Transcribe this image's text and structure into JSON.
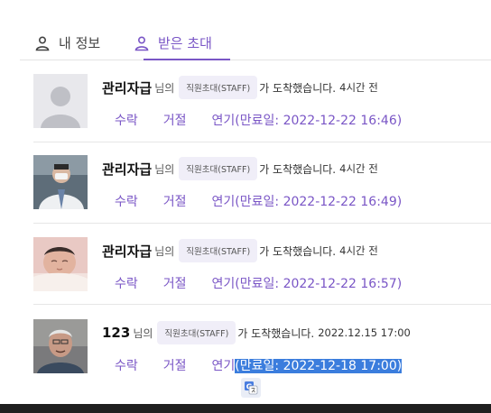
{
  "tabs": [
    {
      "label": "내 정보",
      "icon": "person-icon",
      "active": false
    },
    {
      "label": "받은 초대",
      "icon": "person-icon",
      "active": true
    }
  ],
  "invitations": [
    {
      "name": "관리자급",
      "suffix": "님의",
      "badge": "직원초대(STAFF)",
      "message": "가 도착했습니다.",
      "time": "4시간 전",
      "accept": "수락",
      "reject": "거절",
      "extend_prefix": "연기",
      "extend_rest": "(만료일: 2022-12-22 16:46)",
      "avatar": "default-avatar"
    },
    {
      "name": "관리자급",
      "suffix": "님의",
      "badge": "직원초대(STAFF)",
      "message": "가 도착했습니다.",
      "time": "4시간 전",
      "accept": "수락",
      "reject": "거절",
      "extend_prefix": "연기",
      "extend_rest": "(만료일: 2022-12-22 16:49)",
      "avatar": "doctor-photo"
    },
    {
      "name": "관리자급",
      "suffix": "님의",
      "badge": "직원초대(STAFF)",
      "message": "가 도착했습니다.",
      "time": "4시간 전",
      "accept": "수락",
      "reject": "거절",
      "extend_prefix": "연기",
      "extend_rest": "(만료일: 2022-12-22 16:57)",
      "avatar": "baby-photo"
    },
    {
      "name": "123",
      "suffix": "님의",
      "badge": "직원초대(STAFF)",
      "message": "가 도착했습니다.",
      "time": "2022.12.15 17:00",
      "accept": "수락",
      "reject": "거절",
      "extend_prefix": "연기",
      "extend_rest": "(만료일: 2022-12-18 17:00)",
      "avatar": "elder-photo"
    }
  ],
  "colors": {
    "accent": "#7a56c6",
    "badge_bg": "#f0eef8",
    "selection": "#3b7ddd"
  },
  "overlay": {
    "translate_icon": "google-translate-icon"
  }
}
